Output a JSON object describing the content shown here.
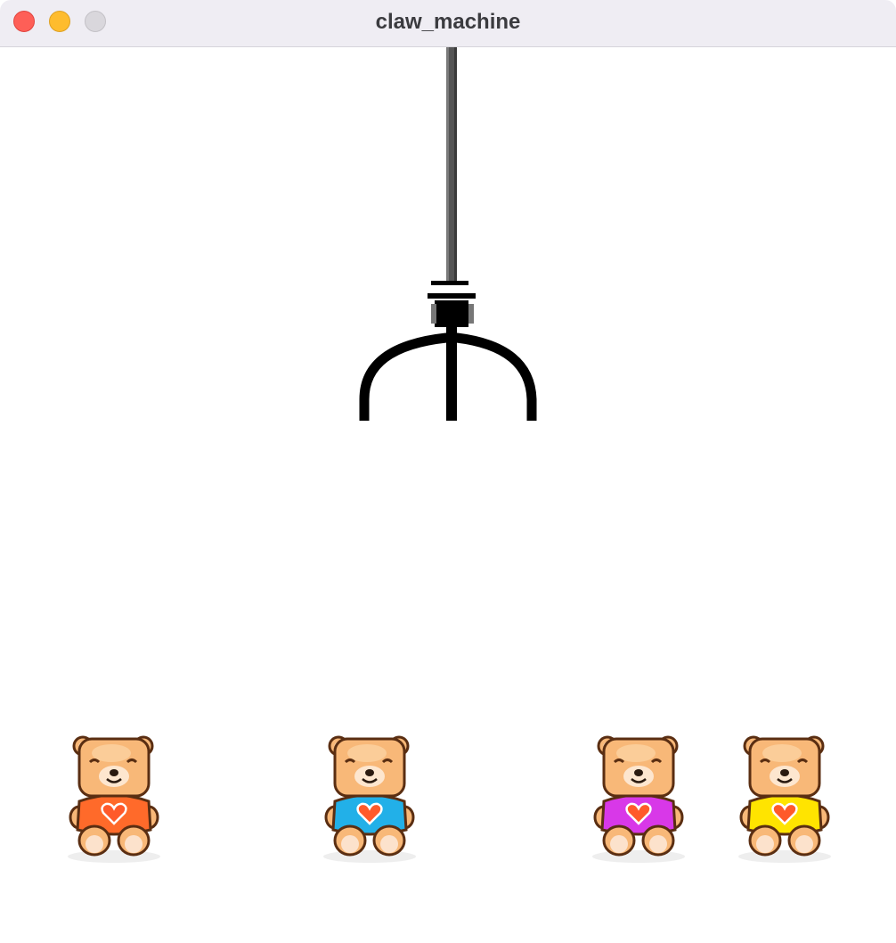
{
  "window": {
    "title": "claw_machine",
    "controls": [
      "close-button",
      "minimize-button",
      "zoom-button"
    ]
  },
  "game": {
    "claw": {
      "state": "open",
      "icon": "claw-icon"
    },
    "prizes": [
      {
        "name": "teddy-bear",
        "shirt_color": "#ff6a2a"
      },
      {
        "name": "teddy-bear",
        "shirt_color": "#22b0e8"
      },
      {
        "name": "teddy-bear",
        "shirt_color": "#d838e8"
      },
      {
        "name": "teddy-bear",
        "shirt_color": "#ffe400"
      }
    ]
  },
  "colors": {
    "close": "#fe5f57",
    "minimize": "#febc2e",
    "zoom": "#d9d7dc",
    "bear_fur": "#f8b878",
    "heart": "#ff5a2a"
  }
}
